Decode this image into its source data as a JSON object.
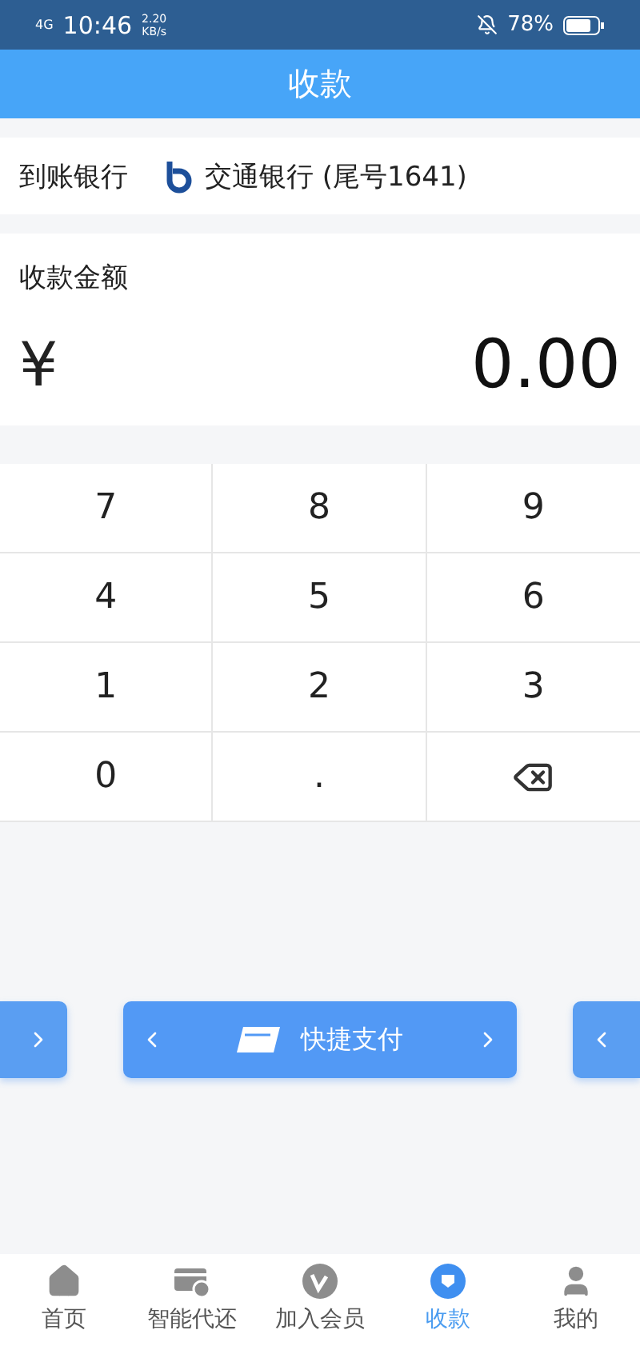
{
  "status_bar": {
    "network": "4G",
    "time": "10:46",
    "speed": "2.20",
    "speed_unit": "KB/s",
    "battery_text": "78%"
  },
  "header": {
    "title": "收款"
  },
  "bank": {
    "label": "到账银行",
    "name": "交通银行 (尾号1641)"
  },
  "amount": {
    "label": "收款金额",
    "currency": "¥",
    "value": "0.00"
  },
  "keypad": [
    {
      "kind": "key",
      "label": "7"
    },
    {
      "kind": "key",
      "label": "8"
    },
    {
      "kind": "key",
      "label": "9"
    },
    {
      "kind": "key",
      "label": "4"
    },
    {
      "kind": "key",
      "label": "5"
    },
    {
      "kind": "key",
      "label": "6"
    },
    {
      "kind": "key",
      "label": "1"
    },
    {
      "kind": "key",
      "label": "2"
    },
    {
      "kind": "key",
      "label": "3"
    },
    {
      "kind": "key",
      "label": "0"
    },
    {
      "kind": "key",
      "label": "."
    },
    {
      "kind": "backspace"
    }
  ],
  "pay_methods": [
    {
      "kind": "peek-left"
    },
    {
      "kind": "main",
      "label": "快捷支付"
    },
    {
      "kind": "peek-right"
    }
  ],
  "tabs": [
    {
      "label": "首页",
      "selected": false
    },
    {
      "label": "智能代还",
      "selected": false
    },
    {
      "label": "加入会员",
      "selected": false
    },
    {
      "label": "收款",
      "selected": true
    },
    {
      "label": "我的",
      "selected": false
    }
  ]
}
